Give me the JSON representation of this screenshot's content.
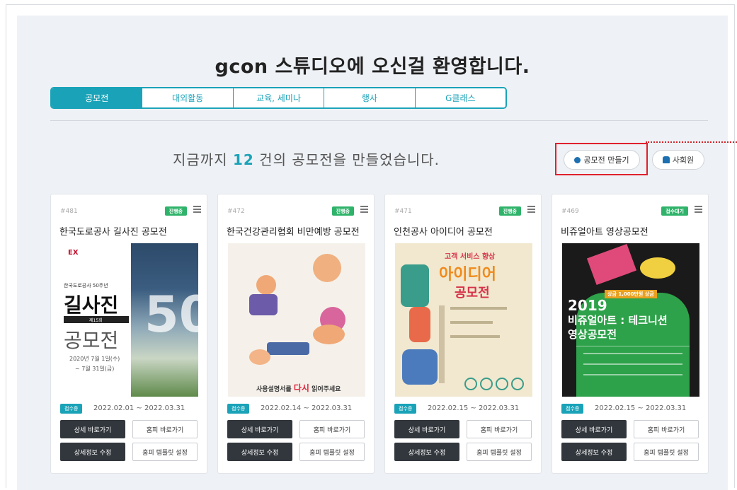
{
  "page": {
    "welcome": "gcon 스튜디오에 오신걸 환영합니다."
  },
  "tabs": [
    {
      "label": "공모전",
      "active": true
    },
    {
      "label": "대외활동",
      "active": false
    },
    {
      "label": "교육, 세미나",
      "active": false
    },
    {
      "label": "행사",
      "active": false
    },
    {
      "label": "G클래스",
      "active": false
    }
  ],
  "summary": {
    "prefix": "지금까지",
    "count": "12",
    "suffix": "건의 공모전을 만들었습니다."
  },
  "actions": {
    "create_label": "공모전 만들기",
    "user_label": "사회원"
  },
  "cards": [
    {
      "num": "#481",
      "badge": "진행중",
      "badge_color": "#2fb36a",
      "title": "한국도로공사 길사진 공모전",
      "status": "접수중",
      "dates": "2022.02.01 ~ 2022.03.31",
      "btn_detail": "상세 바로가기",
      "btn_home": "홈피 바로가기",
      "btn_edit": "상세정보 수정",
      "btn_template": "홈피 템플릿 설정",
      "poster": {
        "line1": "EX",
        "line2": "길사진",
        "line3": "공모전",
        "line4": "2020년 7월 1일(수)",
        "line5": "~ 7월 31일(금)",
        "line6": "제15회",
        "line7": "한국도로공사 50주년"
      }
    },
    {
      "num": "#472",
      "badge": "진행중",
      "badge_color": "#2fb36a",
      "title": "한국건강관리협회 비만예방 공모전",
      "status": "접수중",
      "dates": "2022.02.14 ~ 2022.03.31",
      "btn_detail": "상세 바로가기",
      "btn_home": "홈피 바로가기",
      "btn_edit": "상세정보 수정",
      "btn_template": "홈피 템플릿 설정",
      "poster": {
        "line1": "사용설명서를",
        "line2": "다시",
        "line3": "읽어주세요"
      }
    },
    {
      "num": "#471",
      "badge": "진행중",
      "badge_color": "#2fb36a",
      "title": "인천공사 아이디어 공모전",
      "status": "접수중",
      "dates": "2022.02.15 ~ 2022.03.31",
      "btn_detail": "상세 바로가기",
      "btn_home": "홈피 바로가기",
      "btn_edit": "상세정보 수정",
      "btn_template": "홈피 템플릿 설정",
      "poster": {
        "line1": "고객 서비스 향상",
        "line2": "아이디어",
        "line3": "공모전"
      }
    },
    {
      "num": "#469",
      "badge": "접수대기",
      "badge_color": "#2fb36a",
      "title": "비쥬얼아트 영상공모전",
      "status": "접수중",
      "dates": "2022.02.15 ~ 2022.03.31",
      "btn_detail": "상세 바로가기",
      "btn_home": "홈피 바로가기",
      "btn_edit": "상세정보 수정",
      "btn_template": "홈피 템플릿 설정",
      "poster": {
        "line1": "2019",
        "line2": "비쥬얼아트 : 테크니션",
        "line3": "영상공모전",
        "line4": "상금 1,000만원 상금"
      }
    }
  ]
}
